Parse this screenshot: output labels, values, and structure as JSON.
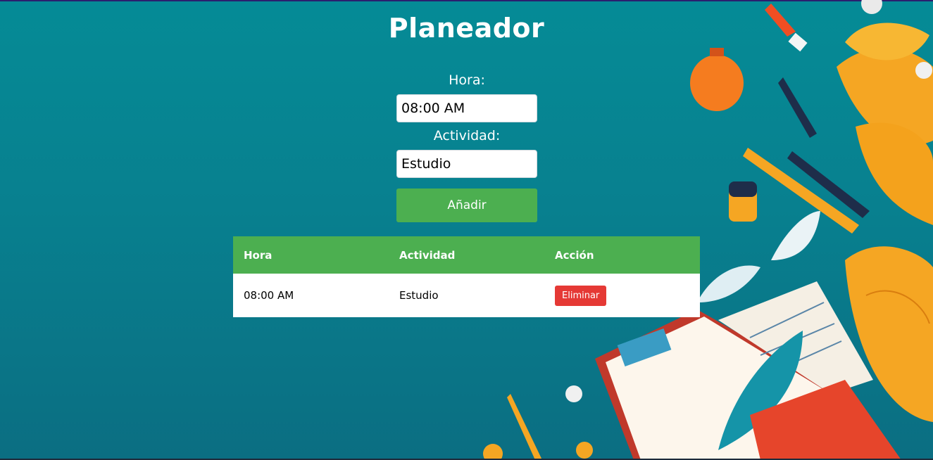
{
  "page": {
    "title": "Planeador"
  },
  "form": {
    "hora_label": "Hora:",
    "hora_value": "08:00 AM",
    "actividad_label": "Actividad:",
    "actividad_value": "Estudio",
    "add_button": "Añadir"
  },
  "table": {
    "headers": [
      "Hora",
      "Actividad",
      "Acción"
    ],
    "rows": [
      {
        "hora": "08:00 AM",
        "actividad": "Estudio",
        "action": "Eliminar"
      }
    ]
  },
  "colors": {
    "accent_green": "#4caf50",
    "delete_red": "#e53935",
    "background_teal": "#058b96"
  }
}
